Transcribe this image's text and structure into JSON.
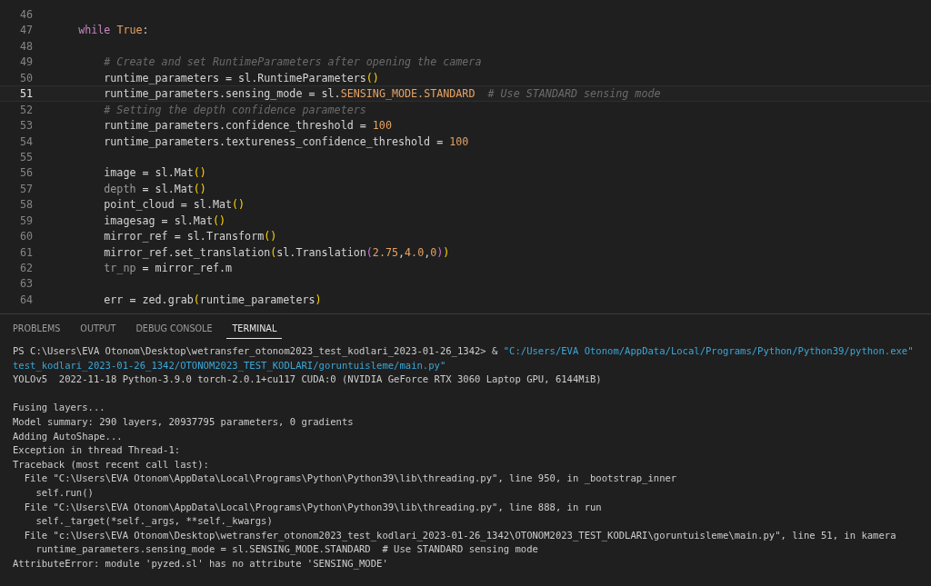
{
  "editor": {
    "lines": [
      {
        "number": "46",
        "current": false
      },
      {
        "number": "47",
        "current": false,
        "tokens": [
          {
            "text": "    while",
            "kind": "kw"
          },
          {
            "text": " True",
            "kind": "const"
          },
          {
            "text": ":",
            "kind": "plain"
          }
        ]
      },
      {
        "number": "48",
        "current": false
      },
      {
        "number": "49",
        "current": false,
        "tokens": [
          {
            "text": "        # Create and set RuntimeParameters after opening the camera",
            "kind": "comment"
          }
        ]
      },
      {
        "number": "50",
        "current": false,
        "tokens": [
          {
            "text": "        runtime_parameters = sl.RuntimeParameters",
            "kind": "plain"
          },
          {
            "text": "()",
            "kind": "paren"
          }
        ]
      },
      {
        "number": "51",
        "current": true,
        "tokens": [
          {
            "text": "        runtime_parameters.sensing_mode = sl.",
            "kind": "plain"
          },
          {
            "text": "SENSING_MODE.STANDARD",
            "kind": "const"
          },
          {
            "text": "  # Use STANDARD sensing mode",
            "kind": "comment"
          }
        ]
      },
      {
        "number": "52",
        "current": false,
        "tokens": [
          {
            "text": "        # Setting the depth confidence parameters",
            "kind": "comment"
          }
        ]
      },
      {
        "number": "53",
        "current": false,
        "tokens": [
          {
            "text": "        runtime_parameters.confidence_threshold = ",
            "kind": "plain"
          },
          {
            "text": "100",
            "kind": "num"
          }
        ]
      },
      {
        "number": "54",
        "current": false,
        "tokens": [
          {
            "text": "        runtime_parameters.textureness_confidence_threshold = ",
            "kind": "plain"
          },
          {
            "text": "100",
            "kind": "num"
          }
        ]
      },
      {
        "number": "55",
        "current": false
      },
      {
        "number": "56",
        "current": false,
        "tokens": [
          {
            "text": "        image = sl.Mat",
            "kind": "plain"
          },
          {
            "text": "()",
            "kind": "paren"
          }
        ]
      },
      {
        "number": "57",
        "current": false,
        "tokens": [
          {
            "text": "        depth",
            "kind": "dim"
          },
          {
            "text": " = sl.Mat",
            "kind": "plain"
          },
          {
            "text": "()",
            "kind": "paren"
          }
        ]
      },
      {
        "number": "58",
        "current": false,
        "tokens": [
          {
            "text": "        point_cloud = sl.Mat",
            "kind": "plain"
          },
          {
            "text": "()",
            "kind": "paren"
          }
        ]
      },
      {
        "number": "59",
        "current": false,
        "tokens": [
          {
            "text": "        imagesag = sl.Mat",
            "kind": "plain"
          },
          {
            "text": "()",
            "kind": "paren"
          }
        ]
      },
      {
        "number": "60",
        "current": false,
        "tokens": [
          {
            "text": "        mirror_ref = sl.Transform",
            "kind": "plain"
          },
          {
            "text": "()",
            "kind": "paren"
          }
        ]
      },
      {
        "number": "61",
        "current": false,
        "tokens": [
          {
            "text": "        mirror_ref.set_translation",
            "kind": "plain"
          },
          {
            "text": "(",
            "kind": "paren"
          },
          {
            "text": "sl.Translation",
            "kind": "plain"
          },
          {
            "text": "(",
            "kind": "paren2"
          },
          {
            "text": "2.75",
            "kind": "num"
          },
          {
            "text": ",",
            "kind": "plain"
          },
          {
            "text": "4.0",
            "kind": "num"
          },
          {
            "text": ",",
            "kind": "plain"
          },
          {
            "text": "0",
            "kind": "num"
          },
          {
            "text": ")",
            "kind": "paren2"
          },
          {
            "text": ")",
            "kind": "paren"
          }
        ]
      },
      {
        "number": "62",
        "current": false,
        "tokens": [
          {
            "text": "        tr_np",
            "kind": "dim"
          },
          {
            "text": " = mirror_ref.m",
            "kind": "plain"
          }
        ]
      },
      {
        "number": "63",
        "current": false
      },
      {
        "number": "64",
        "current": false,
        "tokens": [
          {
            "text": "        err = zed.grab",
            "kind": "plain"
          },
          {
            "text": "(",
            "kind": "paren"
          },
          {
            "text": "runtime_parameters",
            "kind": "plain"
          },
          {
            "text": ")",
            "kind": "paren"
          }
        ]
      }
    ]
  },
  "panel": {
    "tabs": [
      {
        "label": "PROBLEMS",
        "selected": false
      },
      {
        "label": "OUTPUT",
        "selected": false
      },
      {
        "label": "DEBUG CONSOLE",
        "selected": false
      },
      {
        "label": "TERMINAL",
        "selected": true
      }
    ],
    "terminal": [
      {
        "segments": [
          {
            "text": "PS C:\\Users\\EVA Otonom\\Desktop\\wetransfer_otonom2023_test_kodlari_2023-01-26_1342> & ",
            "kind": "plain"
          },
          {
            "text": "\"C:/Users/EVA Otonom/AppData/Local/Programs/Python/Python39/python.exe\"",
            "kind": "string"
          }
        ]
      },
      {
        "segments": [
          {
            "text": "test_kodlari_2023-01-26_1342/OTONOM2023_TEST_KODLARI/goruntuisleme/main.py\"",
            "kind": "string"
          }
        ]
      },
      {
        "segments": [
          {
            "text": "YOLOv5  2022-11-18 Python-3.9.0 torch-2.0.1+cu117 CUDA:0 (NVIDIA GeForce RTX 3060 Laptop GPU, 6144MiB)",
            "kind": "plain"
          }
        ]
      },
      {
        "space_before": true,
        "segments": [
          {
            "text": "Fusing layers...",
            "kind": "plain"
          }
        ]
      },
      {
        "segments": [
          {
            "text": "Model summary: 290 layers, 20937795 parameters, 0 gradients",
            "kind": "plain"
          }
        ]
      },
      {
        "segments": [
          {
            "text": "Adding AutoShape...",
            "kind": "plain"
          }
        ]
      },
      {
        "segments": [
          {
            "text": "Exception in thread Thread-1:",
            "kind": "plain"
          }
        ]
      },
      {
        "segments": [
          {
            "text": "Traceback (most recent call last):",
            "kind": "plain"
          }
        ]
      },
      {
        "segments": [
          {
            "text": "  File \"C:\\Users\\EVA Otonom\\AppData\\Local\\Programs\\Python\\Python39\\lib\\threading.py\", line 950, in _bootstrap_inner",
            "kind": "plain"
          }
        ]
      },
      {
        "segments": [
          {
            "text": "    self.run()",
            "kind": "plain"
          }
        ]
      },
      {
        "segments": [
          {
            "text": "  File \"C:\\Users\\EVA Otonom\\AppData\\Local\\Programs\\Python\\Python39\\lib\\threading.py\", line 888, in run",
            "kind": "plain"
          }
        ]
      },
      {
        "segments": [
          {
            "text": "    self._target(*self._args, **self._kwargs)",
            "kind": "plain"
          }
        ]
      },
      {
        "segments": [
          {
            "text": "  File \"c:\\Users\\EVA Otonom\\Desktop\\wetransfer_otonom2023_test_kodlari_2023-01-26_1342\\OTONOM2023_TEST_KODLARI\\goruntuisleme\\main.py\", line 51, in kamera",
            "kind": "plain"
          }
        ]
      },
      {
        "segments": [
          {
            "text": "    runtime_parameters.sensing_mode = sl.SENSING_MODE.STANDARD  # Use STANDARD sensing mode",
            "kind": "plain"
          }
        ]
      },
      {
        "segments": [
          {
            "text": "AttributeError: module 'pyzed.sl' has no attribute 'SENSING_MODE'",
            "kind": "plain"
          }
        ]
      }
    ]
  }
}
